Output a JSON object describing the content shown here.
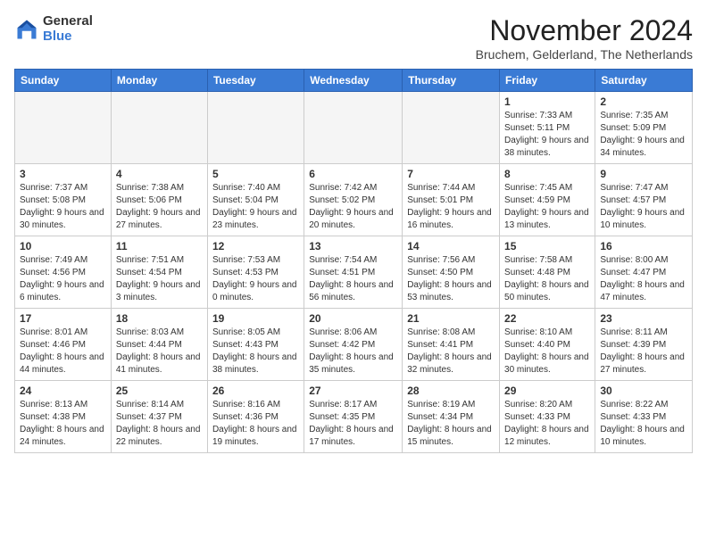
{
  "logo": {
    "general": "General",
    "blue": "Blue"
  },
  "title": "November 2024",
  "location": "Bruchem, Gelderland, The Netherlands",
  "days_of_week": [
    "Sunday",
    "Monday",
    "Tuesday",
    "Wednesday",
    "Thursday",
    "Friday",
    "Saturday"
  ],
  "weeks": [
    [
      {
        "day": "",
        "info": ""
      },
      {
        "day": "",
        "info": ""
      },
      {
        "day": "",
        "info": ""
      },
      {
        "day": "",
        "info": ""
      },
      {
        "day": "",
        "info": ""
      },
      {
        "day": "1",
        "info": "Sunrise: 7:33 AM\nSunset: 5:11 PM\nDaylight: 9 hours and 38 minutes."
      },
      {
        "day": "2",
        "info": "Sunrise: 7:35 AM\nSunset: 5:09 PM\nDaylight: 9 hours and 34 minutes."
      }
    ],
    [
      {
        "day": "3",
        "info": "Sunrise: 7:37 AM\nSunset: 5:08 PM\nDaylight: 9 hours and 30 minutes."
      },
      {
        "day": "4",
        "info": "Sunrise: 7:38 AM\nSunset: 5:06 PM\nDaylight: 9 hours and 27 minutes."
      },
      {
        "day": "5",
        "info": "Sunrise: 7:40 AM\nSunset: 5:04 PM\nDaylight: 9 hours and 23 minutes."
      },
      {
        "day": "6",
        "info": "Sunrise: 7:42 AM\nSunset: 5:02 PM\nDaylight: 9 hours and 20 minutes."
      },
      {
        "day": "7",
        "info": "Sunrise: 7:44 AM\nSunset: 5:01 PM\nDaylight: 9 hours and 16 minutes."
      },
      {
        "day": "8",
        "info": "Sunrise: 7:45 AM\nSunset: 4:59 PM\nDaylight: 9 hours and 13 minutes."
      },
      {
        "day": "9",
        "info": "Sunrise: 7:47 AM\nSunset: 4:57 PM\nDaylight: 9 hours and 10 minutes."
      }
    ],
    [
      {
        "day": "10",
        "info": "Sunrise: 7:49 AM\nSunset: 4:56 PM\nDaylight: 9 hours and 6 minutes."
      },
      {
        "day": "11",
        "info": "Sunrise: 7:51 AM\nSunset: 4:54 PM\nDaylight: 9 hours and 3 minutes."
      },
      {
        "day": "12",
        "info": "Sunrise: 7:53 AM\nSunset: 4:53 PM\nDaylight: 9 hours and 0 minutes."
      },
      {
        "day": "13",
        "info": "Sunrise: 7:54 AM\nSunset: 4:51 PM\nDaylight: 8 hours and 56 minutes."
      },
      {
        "day": "14",
        "info": "Sunrise: 7:56 AM\nSunset: 4:50 PM\nDaylight: 8 hours and 53 minutes."
      },
      {
        "day": "15",
        "info": "Sunrise: 7:58 AM\nSunset: 4:48 PM\nDaylight: 8 hours and 50 minutes."
      },
      {
        "day": "16",
        "info": "Sunrise: 8:00 AM\nSunset: 4:47 PM\nDaylight: 8 hours and 47 minutes."
      }
    ],
    [
      {
        "day": "17",
        "info": "Sunrise: 8:01 AM\nSunset: 4:46 PM\nDaylight: 8 hours and 44 minutes."
      },
      {
        "day": "18",
        "info": "Sunrise: 8:03 AM\nSunset: 4:44 PM\nDaylight: 8 hours and 41 minutes."
      },
      {
        "day": "19",
        "info": "Sunrise: 8:05 AM\nSunset: 4:43 PM\nDaylight: 8 hours and 38 minutes."
      },
      {
        "day": "20",
        "info": "Sunrise: 8:06 AM\nSunset: 4:42 PM\nDaylight: 8 hours and 35 minutes."
      },
      {
        "day": "21",
        "info": "Sunrise: 8:08 AM\nSunset: 4:41 PM\nDaylight: 8 hours and 32 minutes."
      },
      {
        "day": "22",
        "info": "Sunrise: 8:10 AM\nSunset: 4:40 PM\nDaylight: 8 hours and 30 minutes."
      },
      {
        "day": "23",
        "info": "Sunrise: 8:11 AM\nSunset: 4:39 PM\nDaylight: 8 hours and 27 minutes."
      }
    ],
    [
      {
        "day": "24",
        "info": "Sunrise: 8:13 AM\nSunset: 4:38 PM\nDaylight: 8 hours and 24 minutes."
      },
      {
        "day": "25",
        "info": "Sunrise: 8:14 AM\nSunset: 4:37 PM\nDaylight: 8 hours and 22 minutes."
      },
      {
        "day": "26",
        "info": "Sunrise: 8:16 AM\nSunset: 4:36 PM\nDaylight: 8 hours and 19 minutes."
      },
      {
        "day": "27",
        "info": "Sunrise: 8:17 AM\nSunset: 4:35 PM\nDaylight: 8 hours and 17 minutes."
      },
      {
        "day": "28",
        "info": "Sunrise: 8:19 AM\nSunset: 4:34 PM\nDaylight: 8 hours and 15 minutes."
      },
      {
        "day": "29",
        "info": "Sunrise: 8:20 AM\nSunset: 4:33 PM\nDaylight: 8 hours and 12 minutes."
      },
      {
        "day": "30",
        "info": "Sunrise: 8:22 AM\nSunset: 4:33 PM\nDaylight: 8 hours and 10 minutes."
      }
    ]
  ]
}
